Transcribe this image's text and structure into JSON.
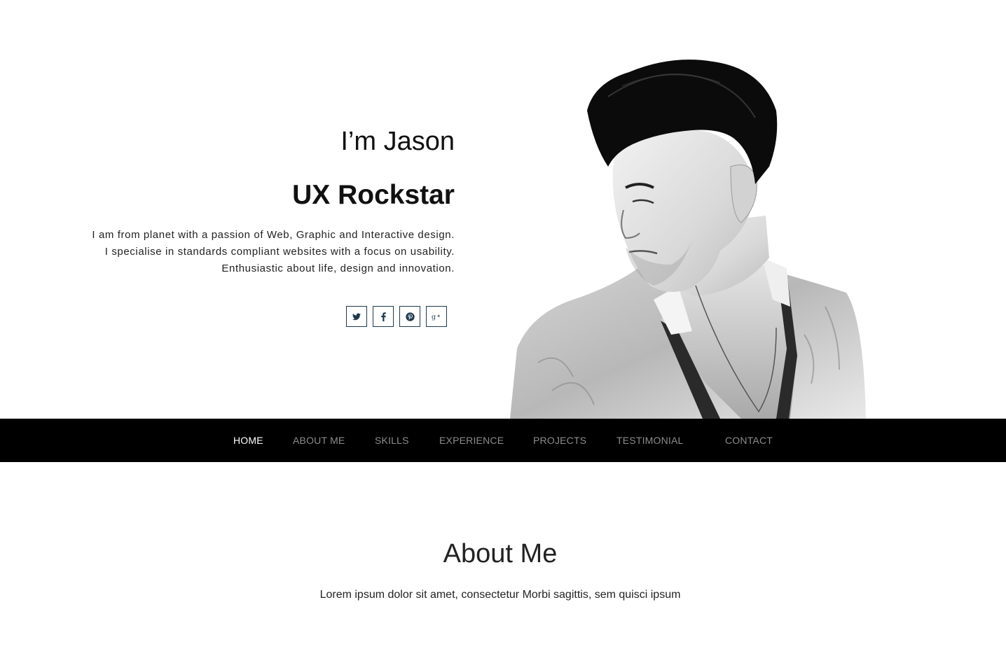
{
  "hero": {
    "greeting": "I’m Jason",
    "role": "UX Rockstar",
    "intro": "I am from planet with a passion of Web, Graphic and Interactive design. I specialise in standards compliant websites with a focus on usability. Enthusiastic about life, design and innovation.",
    "socials": [
      {
        "name": "twitter",
        "icon": "twitter-icon"
      },
      {
        "name": "facebook",
        "icon": "facebook-icon"
      },
      {
        "name": "pinterest",
        "icon": "pinterest-icon"
      },
      {
        "name": "google-plus",
        "icon": "google-plus-icon"
      }
    ]
  },
  "nav": {
    "items": [
      {
        "label": "HOME",
        "active": true
      },
      {
        "label": "ABOUT ME",
        "active": false
      },
      {
        "label": "SKILLS",
        "active": false
      },
      {
        "label": "EXPERIENCE",
        "active": false
      },
      {
        "label": "PROJECTS",
        "active": false
      },
      {
        "label": "TESTIMONIAL",
        "active": false
      },
      {
        "label": "CONTACT",
        "active": false
      }
    ]
  },
  "about": {
    "title": "About Me",
    "text": "Lorem ipsum dolor sit amet, consectetur Morbi sagittis, sem quisci ipsum"
  },
  "colors": {
    "nav_bg": "#000000",
    "nav_active": "#ffffff",
    "nav_inactive": "#8c8c8c",
    "social_border": "#1f3a4d"
  }
}
